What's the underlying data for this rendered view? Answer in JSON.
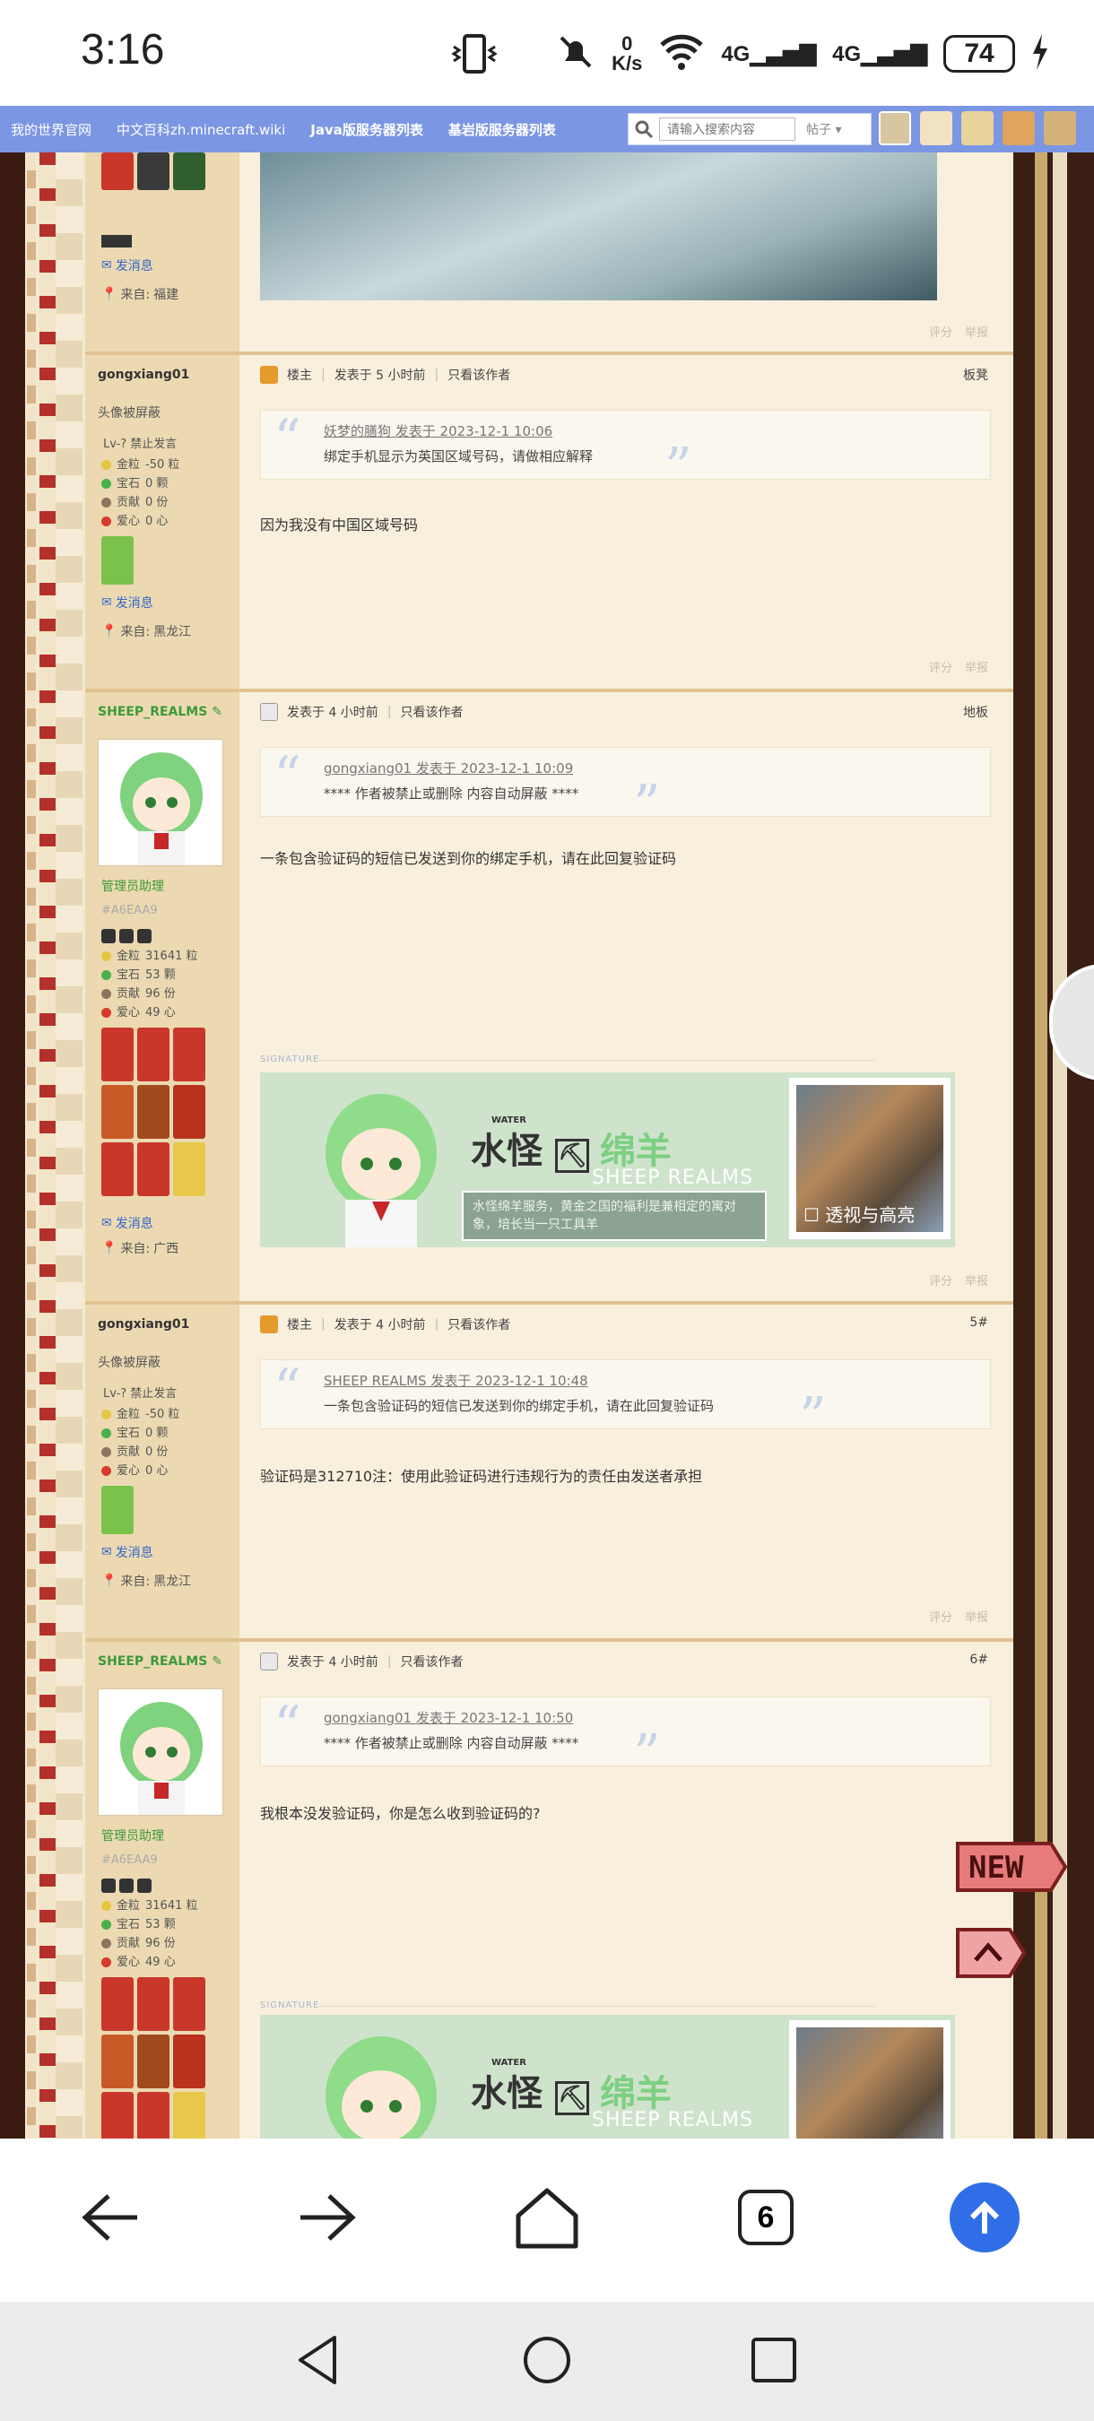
{
  "status_bar": {
    "time": "3:16",
    "net_speed_value": "0",
    "net_speed_unit": "K/s",
    "signal1": "4G",
    "signal2": "4G",
    "battery": "74"
  },
  "topnav": {
    "links": [
      "我的世界官网",
      "中文百科zh.minecraft.wiki",
      "Java版服务器列表",
      "基岩版服务器列表"
    ],
    "search_placeholder": "请输入搜索内容",
    "search_type": "帖子"
  },
  "posts": [
    {
      "from_label": "来自:",
      "from_value": "福建",
      "send_msg": "发消息",
      "actions": [
        "评分",
        "举报"
      ]
    },
    {
      "author": "gongxiang01",
      "avatar_hidden": "头像被屏蔽",
      "level": "Lv-? 禁止发言",
      "stats": [
        [
          "金粒",
          "-50 粒"
        ],
        [
          "宝石",
          "0 颗"
        ],
        [
          "贡献",
          "0 份"
        ],
        [
          "爱心",
          "0 心"
        ]
      ],
      "send_msg": "发消息",
      "from_label": "来自:",
      "from_value": "黑龙江",
      "op_label": "楼主",
      "time": "发表于 5 小时前",
      "only_author": "只看该作者",
      "floor": "板凳",
      "quote_head": "妖梦的膳狗 发表于 2023-12-1 10:06",
      "quote_body": "绑定手机显示为英国区域号码，请做相应解释",
      "text": "因为我没有中国区域号码",
      "actions": [
        "评分",
        "举报"
      ]
    },
    {
      "author": "SHEEP_REALMS",
      "role": "管理员助理",
      "uid": "#A6EAA9",
      "stats": [
        [
          "金粒",
          "31641 粒"
        ],
        [
          "宝石",
          "53 颗"
        ],
        [
          "贡献",
          "96 份"
        ],
        [
          "爱心",
          "49 心"
        ]
      ],
      "send_msg": "发消息",
      "from_label": "来自:",
      "from_value": "广西",
      "time": "发表于 4 小时前",
      "only_author": "只看该作者",
      "floor": "地板",
      "quote_head": "gongxiang01 发表于 2023-12-1 10:09",
      "quote_body": "**** 作者被禁止或删除 内容自动屏蔽 ****",
      "text": "一条包含验证码的短信已发送到你的绑定手机，请在此回复验证码",
      "sig_label": "SIGNATURE",
      "actions": [
        "评分",
        "举报"
      ]
    },
    {
      "author": "gongxiang01",
      "avatar_hidden": "头像被屏蔽",
      "level": "Lv-? 禁止发言",
      "stats": [
        [
          "金粒",
          "-50 粒"
        ],
        [
          "宝石",
          "0 颗"
        ],
        [
          "贡献",
          "0 份"
        ],
        [
          "爱心",
          "0 心"
        ]
      ],
      "send_msg": "发消息",
      "from_label": "来自:",
      "from_value": "黑龙江",
      "op_label": "楼主",
      "time": "发表于 4 小时前",
      "only_author": "只看该作者",
      "floor": "5#",
      "quote_head": "SHEEP REALMS 发表于 2023-12-1 10:48",
      "quote_body": "一条包含验证码的短信已发送到你的绑定手机，请在此回复验证码",
      "text": "验证码是312710注：使用此验证码进行违规行为的责任由发送者承担",
      "actions": [
        "评分",
        "举报"
      ]
    },
    {
      "author": "SHEEP_REALMS",
      "role": "管理员助理",
      "uid": "#A6EAA9",
      "stats": [
        [
          "金粒",
          "31641 粒"
        ],
        [
          "宝石",
          "53 颗"
        ],
        [
          "贡献",
          "96 份"
        ],
        [
          "爱心",
          "49 心"
        ]
      ],
      "time": "发表于 4 小时前",
      "only_author": "只看该作者",
      "floor": "6#",
      "quote_head": "gongxiang01 发表于 2023-12-1 10:50",
      "quote_body": "**** 作者被禁止或删除 内容自动屏蔽 ****",
      "text": "我根本没发验证码，你是怎么收到验证码的?",
      "sig_label": "SIGNATURE"
    }
  ],
  "signature": {
    "brand_cn1": "水怪",
    "brand_cn2": "绵羊",
    "water_tag": "WATER",
    "brand_en": "SHEEP REALMS",
    "desc": "水怪绵羊服务，黄金之国的福利是兼相定的寓对象，培长当一只工具羊",
    "shot_caption": "透视与高亮"
  },
  "floating": {
    "new_label": "NEW"
  },
  "browser": {
    "tab_count": "6"
  },
  "colors": {
    "nav_blue": "#7b96e3",
    "admin_green": "#3c9a3c",
    "accent_blue": "#2f6ee6"
  }
}
